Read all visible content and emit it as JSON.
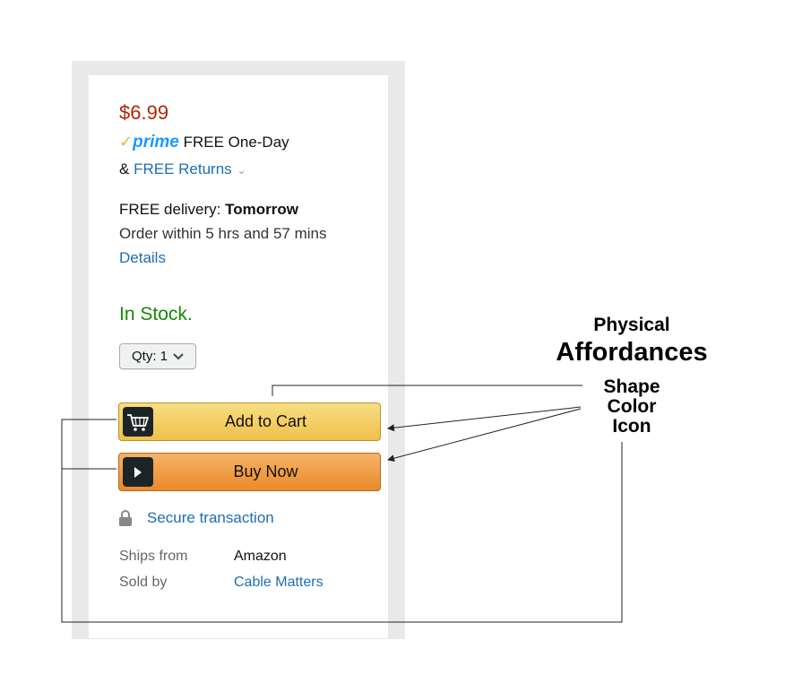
{
  "product": {
    "price": "$6.99",
    "prime_logo": "prime",
    "prime_text": "FREE One-Day",
    "returns_prefix": "& ",
    "returns_link": "FREE Returns",
    "delivery_prefix": "FREE delivery: ",
    "delivery_day": "Tomorrow",
    "order_within": "Order within 5 hrs and 57 mins",
    "details_link": "Details",
    "stock_status": "In Stock.",
    "qty_label": "Qty: 1",
    "add_to_cart_label": "Add to Cart",
    "buy_now_label": "Buy Now",
    "secure_label": "Secure transaction",
    "ships_from_label": "Ships from",
    "ships_from_value": "Amazon",
    "sold_by_label": "Sold by",
    "sold_by_value": "Cable Matters"
  },
  "annotation": {
    "line1": "Physical",
    "line2": "Affordances",
    "word_shape": "Shape",
    "word_color": "Color",
    "word_icon": "Icon"
  },
  "colors": {
    "price": "#b12704",
    "stock": "#138a00",
    "link": "#1d6eae",
    "add_to_cart": "#f0c14b",
    "buy_now": "#ea8a2a"
  },
  "icons": {
    "prime_check": "check-icon",
    "returns_chevron": "chevron-down-icon",
    "qty_chevron": "chevron-down-icon",
    "cart": "cart-icon",
    "play": "play-icon",
    "lock": "lock-icon"
  }
}
